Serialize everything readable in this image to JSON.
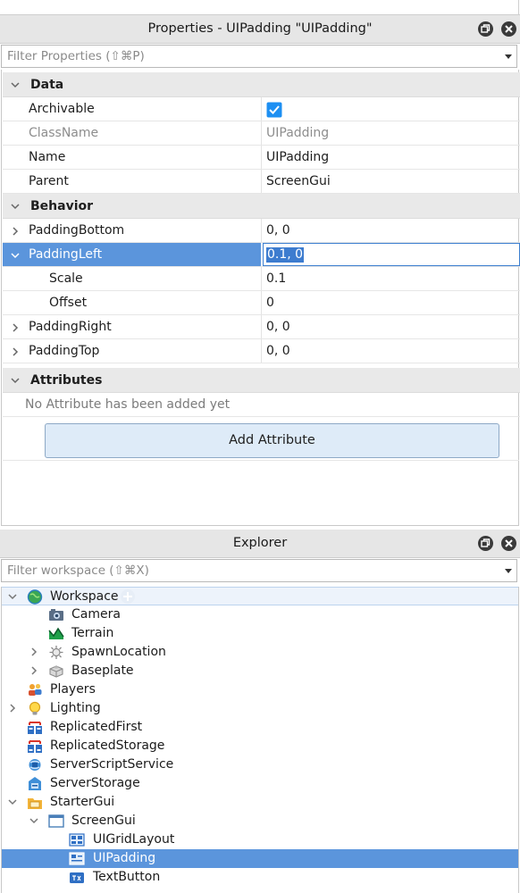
{
  "properties": {
    "title": "Properties - UIPadding \"UIPadding\"",
    "filter_placeholder": "Filter Properties (⇧⌘P)",
    "sections": {
      "data": "Data",
      "behavior": "Behavior",
      "attributes": "Attributes"
    },
    "rows": {
      "archivable": {
        "name": "Archivable",
        "checked": true
      },
      "classname": {
        "name": "ClassName",
        "value": "UIPadding"
      },
      "name": {
        "name": "Name",
        "value": "UIPadding"
      },
      "parent": {
        "name": "Parent",
        "value": "ScreenGui"
      },
      "padding_bottom": {
        "name": "PaddingBottom",
        "value": "0, 0"
      },
      "padding_left": {
        "name": "PaddingLeft",
        "value": "0.1, 0"
      },
      "scale": {
        "name": "Scale",
        "value": "0.1"
      },
      "offset": {
        "name": "Offset",
        "value": "0"
      },
      "padding_right": {
        "name": "PaddingRight",
        "value": "0, 0"
      },
      "padding_top": {
        "name": "PaddingTop",
        "value": "0, 0"
      }
    },
    "no_attributes": "No Attribute has been added yet",
    "add_attribute": "Add Attribute"
  },
  "explorer": {
    "title": "Explorer",
    "filter_placeholder": "Filter workspace (⇧⌘X)",
    "items": {
      "workspace": "Workspace",
      "camera": "Camera",
      "terrain": "Terrain",
      "spawnlocation": "SpawnLocation",
      "baseplate": "Baseplate",
      "players": "Players",
      "lighting": "Lighting",
      "replicatedfirst": "ReplicatedFirst",
      "replicatedstorage": "ReplicatedStorage",
      "serverscriptservice": "ServerScriptService",
      "serverstorage": "ServerStorage",
      "startergui": "StarterGui",
      "screengui": "ScreenGui",
      "uigridlayout": "UIGridLayout",
      "uipadding": "UIPadding",
      "textbutton": "TextButton"
    }
  },
  "colors": {
    "selection": "#5b95dc",
    "section_bg": "#e9e9e9",
    "titlebar_bg": "#e6e6e6",
    "checkbox": "#1d8ff2"
  }
}
